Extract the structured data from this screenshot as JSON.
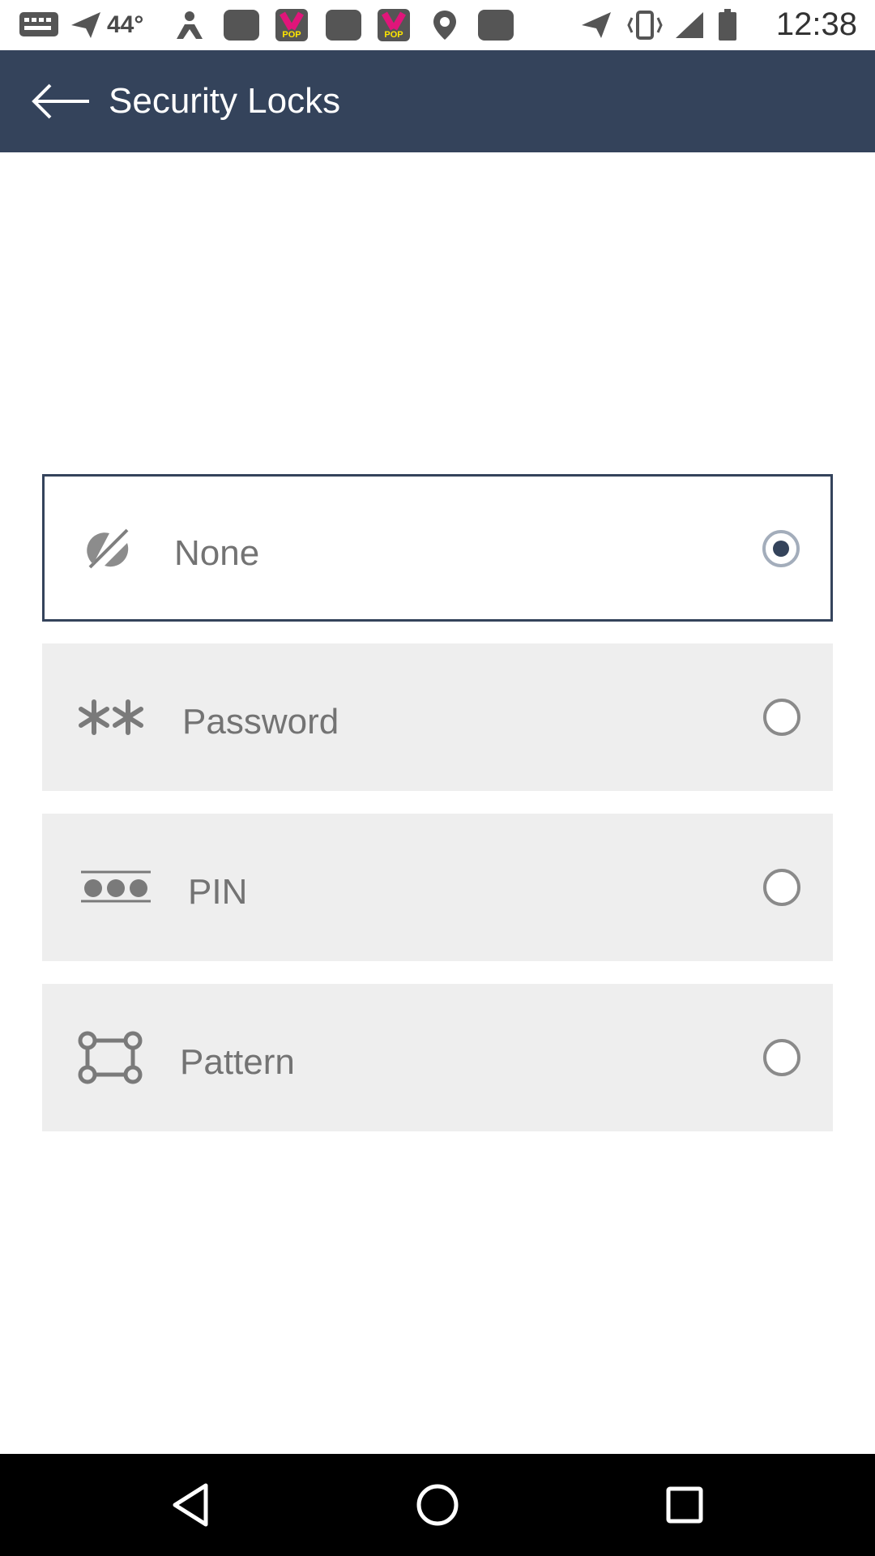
{
  "status_bar": {
    "temperature": "44°",
    "badge_text": "POP",
    "time": "12:38"
  },
  "app_bar": {
    "title": "Security Locks",
    "background_color": "#34435b"
  },
  "options": [
    {
      "label": "None",
      "icon": "no-lock-icon",
      "selected": true
    },
    {
      "label": "Password",
      "icon": "asterisks-icon",
      "selected": false
    },
    {
      "label": "PIN",
      "icon": "pin-dots-icon",
      "selected": false
    },
    {
      "label": "Pattern",
      "icon": "pattern-grid-icon",
      "selected": false
    }
  ],
  "colors": {
    "accent": "#34435b",
    "option_background": "#eeeeee",
    "label_text": "#737373"
  }
}
